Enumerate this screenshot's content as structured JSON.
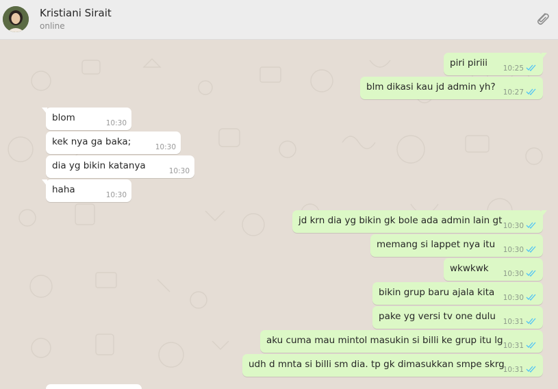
{
  "header": {
    "name": "Kristiani Sirait",
    "status": "online",
    "attach_icon": "paperclip-icon"
  },
  "colors": {
    "outgoing_bubble": "#dcf8c6",
    "incoming_bubble": "#ffffff",
    "read_ticks": "#4fc3f7",
    "chat_background": "#e5ddd5"
  },
  "messages": [
    {
      "dir": "out",
      "text": "piri piriii",
      "time": "10:25",
      "ticks": "read"
    },
    {
      "dir": "out",
      "text": "blm dikasi kau jd admin yh?",
      "time": "10:27",
      "ticks": "read"
    },
    {
      "dir": "in",
      "text": "blom",
      "time": "10:30"
    },
    {
      "dir": "in",
      "text": "kek nya ga baka;",
      "time": "10:30"
    },
    {
      "dir": "in",
      "text": "dia yg bikin katanya",
      "time": "10:30"
    },
    {
      "dir": "in",
      "text": "haha",
      "time": "10:30"
    },
    {
      "dir": "out",
      "text": "jd krn dia yg bikin gk bole ada admin lain gt",
      "time": "10:30",
      "ticks": "read"
    },
    {
      "dir": "out",
      "text": "memang si lappet nya itu",
      "time": "10:30",
      "ticks": "read"
    },
    {
      "dir": "out",
      "text": "wkwkwk",
      "time": "10:30",
      "ticks": "read"
    },
    {
      "dir": "out",
      "text": "bikin grup baru ajala kita",
      "time": "10:30",
      "ticks": "read"
    },
    {
      "dir": "out",
      "text": "pake yg versi tv one dulu",
      "time": "10:31",
      "ticks": "read"
    },
    {
      "dir": "out",
      "text": "aku cuma mau mintol masukin si billi ke grup itu lg",
      "time": "10:31",
      "ticks": "read"
    },
    {
      "dir": "out",
      "text": "udh d mnta si billi sm dia. tp gk dimasukkan smpe skrg",
      "time": "10:31",
      "ticks": "read"
    }
  ]
}
